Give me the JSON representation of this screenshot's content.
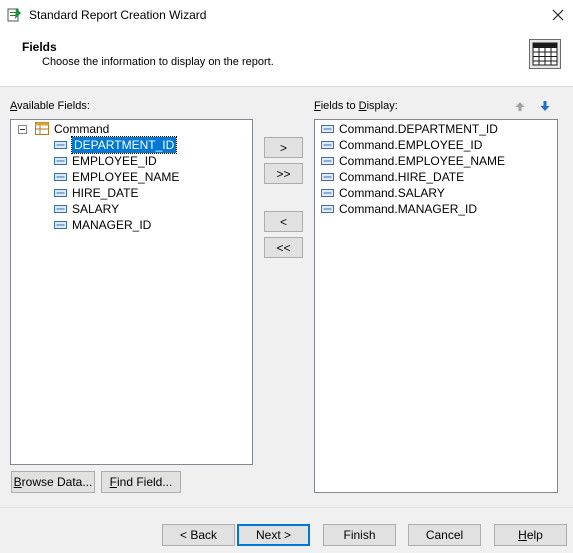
{
  "window": {
    "title": "Standard Report Creation Wizard"
  },
  "header": {
    "title": "Fields",
    "subtitle": "Choose the information to display on the report."
  },
  "available": {
    "label_accel": "A",
    "label_rest": "vailable Fields:",
    "root": "Command",
    "fields": [
      "DEPARTMENT_ID",
      "EMPLOYEE_ID",
      "EMPLOYEE_NAME",
      "HIRE_DATE",
      "SALARY",
      "MANAGER_ID"
    ],
    "selected_index": 0
  },
  "display": {
    "label_accel": "F",
    "label_mid": "ields to ",
    "label_accel2": "D",
    "label_rest": "isplay:",
    "fields": [
      "Command.DEPARTMENT_ID",
      "Command.EMPLOYEE_ID",
      "Command.EMPLOYEE_NAME",
      "Command.HIRE_DATE",
      "Command.SALARY",
      "Command.MANAGER_ID"
    ]
  },
  "transfer": {
    "add": ">",
    "add_all": ">>",
    "remove": "<",
    "remove_all": "<<"
  },
  "bottom": {
    "browse_accel": "B",
    "browse_rest": "rowse Data...",
    "find_accel": "F",
    "find_rest": "ind Field..."
  },
  "footer": {
    "back": "< Back",
    "next": "Next >",
    "finish": "Finish",
    "cancel": "Cancel",
    "help_accel": "H",
    "help_rest": "elp"
  },
  "colors": {
    "selection": "#0078d7",
    "move_up_disabled": "#a0a0a0",
    "move_down": "#1e6fd0"
  },
  "icons": {
    "app": "wizard-icon",
    "close": "close-icon",
    "header": "report-table-icon",
    "root": "table-icon",
    "field": "field-icon",
    "collapse": "collapse-icon",
    "move_up": "arrow-up-icon",
    "move_down": "arrow-down-icon"
  }
}
